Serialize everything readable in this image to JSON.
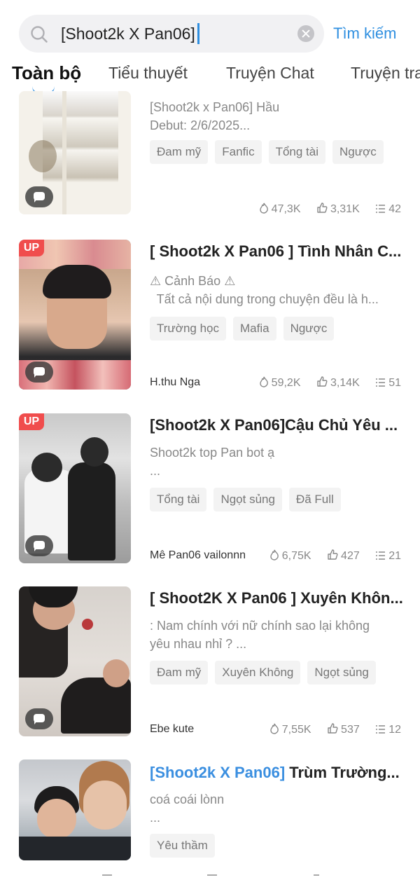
{
  "search": {
    "query": "[Shoot2k X Pan06]",
    "button_label": "Tìm kiếm"
  },
  "tabs": [
    {
      "label": "Toàn bộ",
      "active": true
    },
    {
      "label": "Tiểu thuyết"
    },
    {
      "label": "Truyện Chat"
    },
    {
      "label": "Truyện tra"
    }
  ],
  "stories": [
    {
      "title_highlight": "",
      "title": "",
      "description": "[Shoot2k x Pan06] Hầu\nDebut: 2/6/2025...",
      "tags": [
        "Đam mỹ",
        "Fanfic",
        "Tổng tài",
        "Ngược"
      ],
      "author": "",
      "up": false,
      "views": "47,3K",
      "likes": "3,31K",
      "chapters": "42"
    },
    {
      "title_highlight": "",
      "title": "[ Shoot2k X Pan06 ] Tình Nhân C...",
      "description": "⚠ Cảnh Báo ⚠\n  Tất cả nội dung trong chuyện đều là h...",
      "tags": [
        "Trường học",
        "Mafia",
        "Ngược"
      ],
      "author": "H.thu Nga",
      "up": true,
      "views": "59,2K",
      "likes": "3,14K",
      "chapters": "51"
    },
    {
      "title_highlight": "",
      "title": "[Shoot2k X Pan06]Cậu Chủ Yêu ...",
      "description": "Shoot2k top Pan bot ạ\n...",
      "tags": [
        "Tổng tài",
        "Ngọt sủng",
        "Đã Full"
      ],
      "author": "Mê Pan06 vailonnn",
      "up": true,
      "views": "6,75K",
      "likes": "427",
      "chapters": "21"
    },
    {
      "title_highlight": "",
      "title": "[ Shoot2K X Pan06 ] Xuyên Khôn...",
      "description": ": Nam chính với nữ chính sao lại không\nyêu nhau nhỉ ? ...",
      "tags": [
        "Đam mỹ",
        "Xuyên Không",
        "Ngọt sủng"
      ],
      "author": "Ebe kute",
      "up": false,
      "views": "7,55K",
      "likes": "537",
      "chapters": "12"
    },
    {
      "title_highlight": "[Shoot2k X Pan06]",
      "title": " Trùm Trường...",
      "description": "coá coái lònn\n...",
      "tags": [
        "Yêu thầm"
      ],
      "author": "",
      "up": false,
      "views": "",
      "likes": "",
      "chapters": ""
    }
  ],
  "colors": {
    "accent": "#2f8fe0",
    "up_badge": "#f04d4d"
  },
  "icons": {
    "views": "fire-icon",
    "likes": "thumb-up-icon",
    "chapters": "list-icon"
  }
}
